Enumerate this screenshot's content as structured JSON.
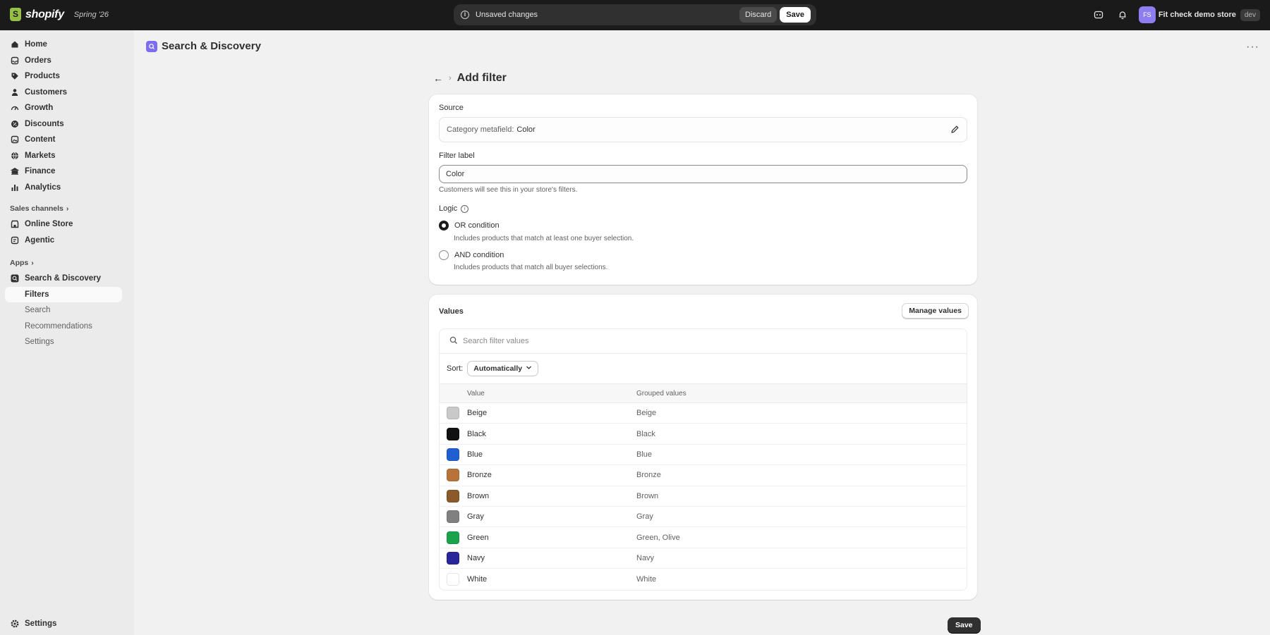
{
  "topbar": {
    "brand": "shopify",
    "edition": "Spring '26",
    "unsaved_message": "Unsaved changes",
    "discard_label": "Discard",
    "save_label": "Save",
    "avatar_initials": "FS",
    "store_name": "Fit check demo store",
    "env_badge": "dev"
  },
  "sidebar": {
    "items": [
      {
        "label": "Home",
        "icon": "home-icon"
      },
      {
        "label": "Orders",
        "icon": "orders-icon"
      },
      {
        "label": "Products",
        "icon": "tag-icon"
      },
      {
        "label": "Customers",
        "icon": "person-icon"
      },
      {
        "label": "Growth",
        "icon": "gauge-icon"
      },
      {
        "label": "Discounts",
        "icon": "discount-icon"
      },
      {
        "label": "Content",
        "icon": "content-icon"
      },
      {
        "label": "Markets",
        "icon": "globe-icon"
      },
      {
        "label": "Finance",
        "icon": "bank-icon"
      },
      {
        "label": "Analytics",
        "icon": "chart-icon"
      }
    ],
    "sales_channels_label": "Sales channels",
    "channels": [
      {
        "label": "Online Store",
        "icon": "store-icon"
      },
      {
        "label": "Agentic",
        "icon": "agentic-icon"
      }
    ],
    "apps_label": "Apps",
    "app": {
      "label": "Search & Discovery",
      "icon": "search-discovery-icon"
    },
    "app_subitems": [
      "Filters",
      "Search",
      "Recommendations",
      "Settings"
    ],
    "settings_label": "Settings"
  },
  "page": {
    "app_title": "Search & Discovery",
    "subtitle": "Add filter"
  },
  "form": {
    "source_label": "Source",
    "source_key": "Category metafield:",
    "source_value": "Color",
    "filter_label_label": "Filter label",
    "filter_label_value": "Color",
    "filter_label_help": "Customers will see this in your store's filters.",
    "logic_label": "Logic",
    "or_label": "OR condition",
    "or_desc": "Includes products that match at least one buyer selection.",
    "and_label": "AND condition",
    "and_desc": "Includes products that match all buyer selections.",
    "selected_logic": "OR condition"
  },
  "values": {
    "title": "Values",
    "manage_label": "Manage values",
    "search_placeholder": "Search filter values",
    "sort_label": "Sort:",
    "sort_value": "Automatically",
    "col_value": "Value",
    "col_grouped": "Grouped values",
    "rows": [
      {
        "value": "Beige",
        "grouped": "Beige",
        "color": "#c9c9c9"
      },
      {
        "value": "Black",
        "grouped": "Black",
        "color": "#111111"
      },
      {
        "value": "Blue",
        "grouped": "Blue",
        "color": "#1f5fd1"
      },
      {
        "value": "Bronze",
        "grouped": "Bronze",
        "color": "#b8733a"
      },
      {
        "value": "Brown",
        "grouped": "Brown",
        "color": "#8b5a2b"
      },
      {
        "value": "Gray",
        "grouped": "Gray",
        "color": "#808080"
      },
      {
        "value": "Green",
        "grouped": "Green, Olive",
        "color": "#1aa34a"
      },
      {
        "value": "Navy",
        "grouped": "Navy",
        "color": "#29259a"
      },
      {
        "value": "White",
        "grouped": "White",
        "color": "#ffffff"
      }
    ]
  },
  "footer": {
    "save_label": "Save"
  }
}
